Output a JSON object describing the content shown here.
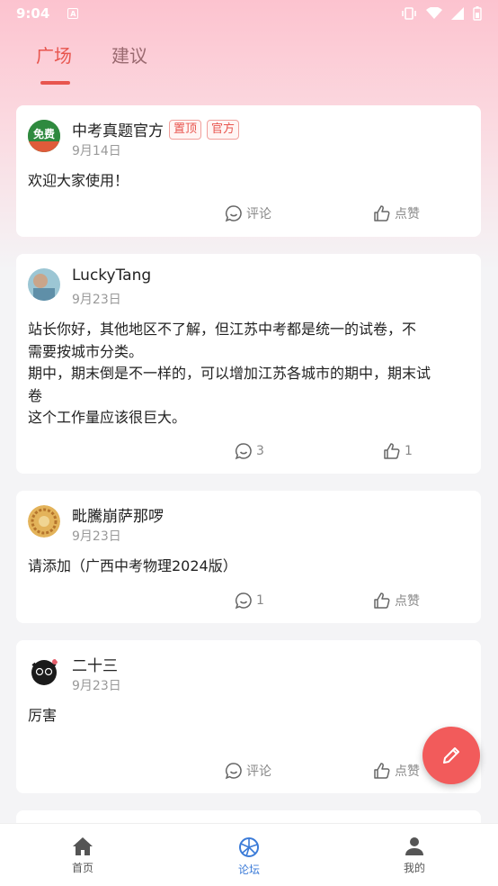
{
  "status_bar": {
    "time": "9:04",
    "a_badge": "A"
  },
  "tabs": [
    {
      "label": "广场",
      "active": true
    },
    {
      "label": "建议",
      "active": false
    }
  ],
  "posts": [
    {
      "author": "中考真题官方",
      "badges": [
        "置顶",
        "官方"
      ],
      "date": "9月14日",
      "avatar_text": "免费",
      "content": "欢迎大家使用！",
      "comments": "评论",
      "likes": "点赞"
    },
    {
      "author": "LuckyTang",
      "date": "9月23日",
      "content_lines": [
        "站长你好，其他地区不了解，但江苏中考都是统一的试卷，不",
        "需要按城市分类。",
        "期中，期末倒是不一样的，可以增加江苏各城市的期中，期末试",
        "卷",
        "这个工作量应该很巨大。"
      ],
      "comments": "3",
      "likes": "1"
    },
    {
      "author": "毗騰崩萨那啰",
      "date": "9月23日",
      "content": "请添加（广西中考物理2024版）",
      "comments": "1",
      "likes": "点赞"
    },
    {
      "author": "二十三",
      "date": "9月23日",
      "content": "厉害",
      "comments": "评论",
      "likes": "点赞"
    }
  ],
  "bottom_nav": [
    {
      "label": "首页",
      "icon": "home-icon",
      "active": false
    },
    {
      "label": "论坛",
      "icon": "forum-icon",
      "active": true
    },
    {
      "label": "我的",
      "icon": "profile-icon",
      "active": false
    }
  ],
  "colors": {
    "accent": "#e8554e",
    "nav_active": "#3b7bd8",
    "fab": "#f25b5b"
  }
}
